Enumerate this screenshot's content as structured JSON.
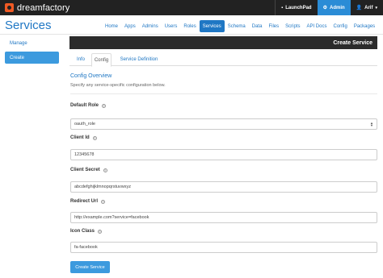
{
  "topbar": {
    "logo_text": "dreamfactory",
    "launchpad_label": "LaunchPad",
    "admin_label": "Admin",
    "user_label": "Arif"
  },
  "page": {
    "title": "Services"
  },
  "nav": {
    "items": [
      "Home",
      "Apps",
      "Admins",
      "Users",
      "Roles",
      "Services",
      "Schema",
      "Data",
      "Files",
      "Scripts",
      "API Docs",
      "Config",
      "Packages"
    ],
    "active": "Services"
  },
  "sidebar": {
    "items": [
      {
        "label": "Manage"
      },
      {
        "label": "Create"
      }
    ]
  },
  "header": {
    "title": "Create Service"
  },
  "tabs": {
    "items": [
      {
        "label": "Info"
      },
      {
        "label": "Config"
      },
      {
        "label": "Service Definition"
      }
    ]
  },
  "config": {
    "section_title": "Config Overview",
    "section_desc": "Specify any service-specific configuration below.",
    "default_role": {
      "label": "Default Role",
      "value": "oauth_role"
    },
    "client_id": {
      "label": "Client Id",
      "value": "12345678"
    },
    "client_secret": {
      "label": "Client Secret",
      "value": "abcdefghijklmnopqrstuvwxyz"
    },
    "redirect_url": {
      "label": "Redirect Url",
      "value": "http://example.com?service=facebook"
    },
    "icon_class": {
      "label": "Icon Class",
      "value": "fa-facebook"
    },
    "submit_label": "Create Service"
  },
  "colors": {
    "accent": "#1f77c4",
    "active_button": "#3c9ade",
    "topbar": "#222222",
    "logo": "#f15a24"
  }
}
